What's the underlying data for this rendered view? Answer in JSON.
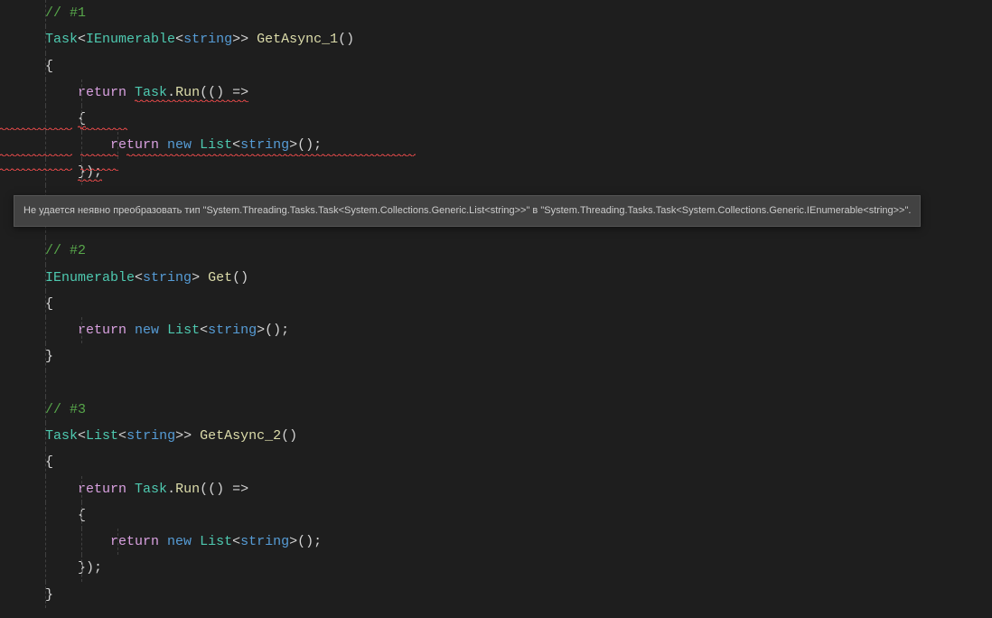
{
  "code": {
    "c1": "// #1",
    "c2": "// #2",
    "c3": "// #3",
    "task": "Task",
    "ienumerable": "IEnumerable",
    "list": "List",
    "string": "string",
    "getasync1": "GetAsync_1",
    "getasync2": "GetAsync_2",
    "get": "Get",
    "return": "return",
    "new": "new",
    "run": "Run",
    "lt": "<",
    "gt": ">",
    "lparen": "(",
    "rparen": ")",
    "lbrace": "{",
    "rbrace": "}",
    "arrow": " =>",
    "semi": ";",
    "dot": ".",
    "empty_parens": "()",
    "rbrace_paren_semi": "});"
  },
  "tooltip": {
    "text": "Не удается неявно преобразовать тип \"System.Threading.Tasks.Task<System.Collections.Generic.List<string>>\" в \"System.Threading.Tasks.Task<System.Collections.Generic.IEnumerable<string>>\"."
  }
}
